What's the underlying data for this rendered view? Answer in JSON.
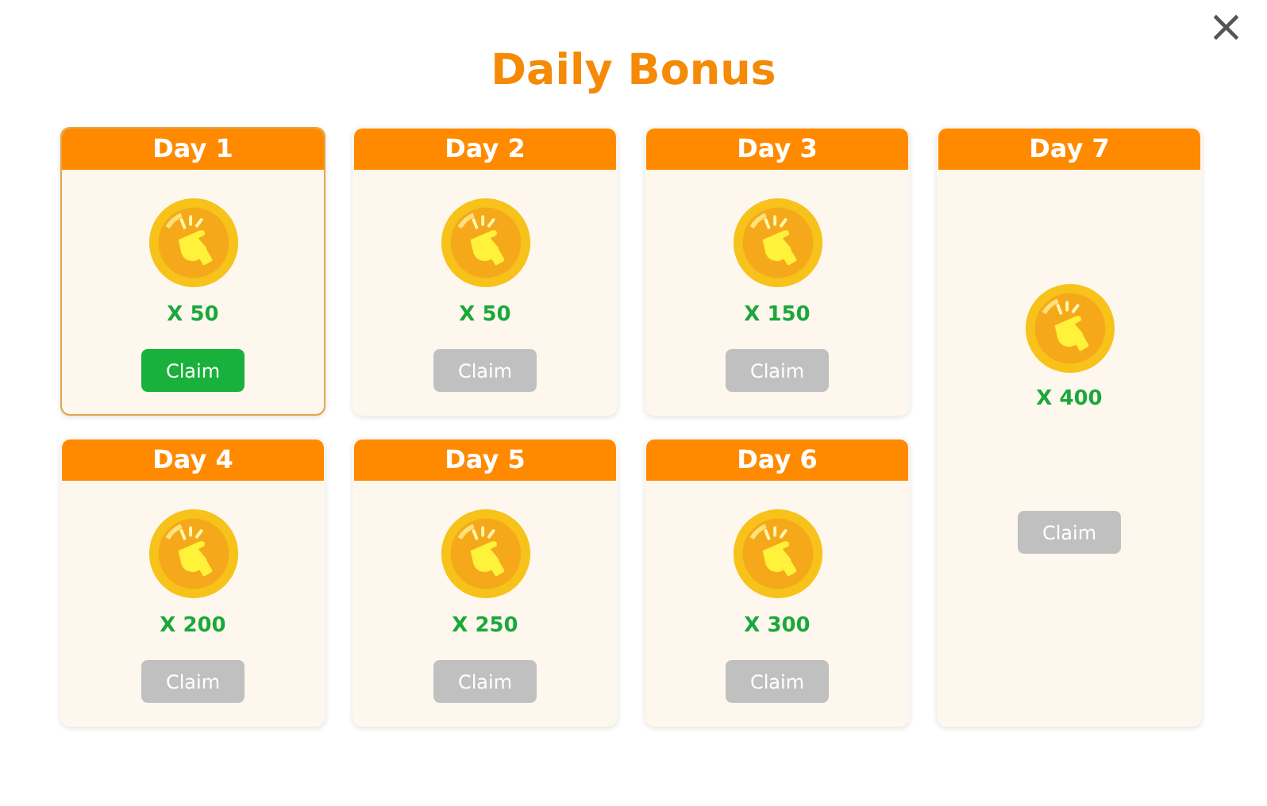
{
  "title": "Daily Bonus",
  "close": "×",
  "days": [
    {
      "label": "Day 1",
      "amount": "X 50",
      "button": "Claim",
      "claimable": true,
      "kind": "small"
    },
    {
      "label": "Day 2",
      "amount": "X 50",
      "button": "Claim",
      "claimable": false,
      "kind": "small"
    },
    {
      "label": "Day 3",
      "amount": "X 150",
      "button": "Claim",
      "claimable": false,
      "kind": "small"
    },
    {
      "label": "Day 7",
      "amount": "X 400",
      "button": "Claim",
      "claimable": false,
      "kind": "big"
    },
    {
      "label": "Day 4",
      "amount": "X 200",
      "button": "Claim",
      "claimable": false,
      "kind": "small"
    },
    {
      "label": "Day 5",
      "amount": "X 250",
      "button": "Claim",
      "claimable": false,
      "kind": "small"
    },
    {
      "label": "Day 6",
      "amount": "X 300",
      "button": "Claim",
      "claimable": false,
      "kind": "small"
    }
  ]
}
